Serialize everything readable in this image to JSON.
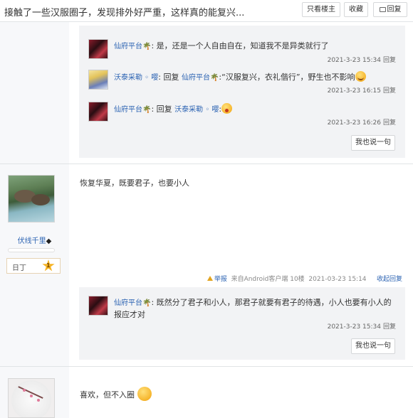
{
  "header": {
    "title": "接触了一些汉服圈子，发现排外好严重，这样真的能复兴...",
    "only_op_label": "只看楼主",
    "favorite_label": "收藏",
    "reply_label": "回复"
  },
  "floor1": {
    "sub_replies": [
      {
        "user": "仙府平台",
        "badge": "🌴",
        "text": "是，还是一个人自由自在，知道我不是异类就行了",
        "time": "2021-3-23 15:34",
        "reply_label": "回复"
      },
      {
        "user": "沃泰采勒 ◦ 嘤",
        "prefix": "回复",
        "target": "仙府平台",
        "target_badge": "🌴",
        "text": ":“汉服复兴，衣礼偕行”，野生也不影响",
        "time": "2021-3-23 16:15",
        "reply_label": "回复"
      },
      {
        "user": "仙府平台",
        "badge": "🌴",
        "prefix": "回复",
        "target": "沃泰采勒 ◦ 嘤",
        "text": ":",
        "time": "2021-3-23 16:26",
        "reply_label": "回复"
      }
    ],
    "say_button": "我也说一句"
  },
  "floor2": {
    "username": "伏线千里",
    "username_badge": "◆",
    "level_name": "日丁",
    "level_num": "1",
    "content": "恢复华夏，既要君子，也要小人",
    "report_label": "举报",
    "source": "来自Android客户端",
    "floor_no": "10楼",
    "time": "2021-03-23 15:14",
    "collapse_label": "收起回复",
    "sub_replies": [
      {
        "user": "仙府平台",
        "badge": "🌴",
        "text": "既然分了君子和小人，那君子就要有君子的待遇，小人也要有小人的报应才对",
        "time": "2021-3-23 15:34",
        "reply_label": "回复"
      }
    ],
    "say_button": "我也说一句"
  },
  "floor3": {
    "content": "喜欢，但不入圈"
  },
  "colors": {
    "link": "#2d64b3",
    "badge_palm": "#2d9b3a",
    "panel": "#f2f3f5",
    "leftcol": "#f7f8fa"
  }
}
